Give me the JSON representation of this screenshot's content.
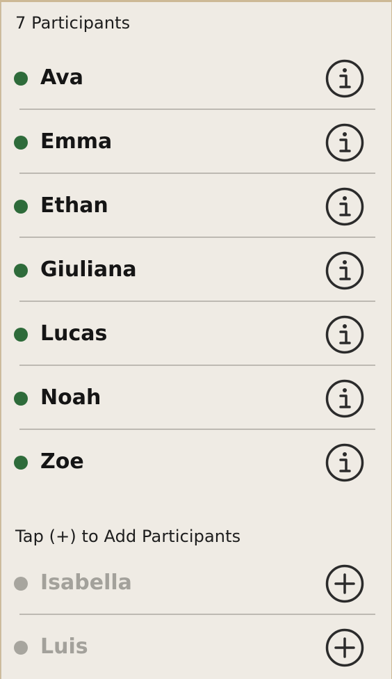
{
  "participants": {
    "title": "7 Participants",
    "items": [
      {
        "name": "Ava"
      },
      {
        "name": "Emma"
      },
      {
        "name": "Ethan"
      },
      {
        "name": "Giuliana"
      },
      {
        "name": "Lucas"
      },
      {
        "name": "Noah"
      },
      {
        "name": "Zoe"
      }
    ],
    "action_icon": "info-icon",
    "status_color": "#2e6b3a"
  },
  "available": {
    "title": "Tap (+) to Add Participants",
    "items": [
      {
        "name": "Isabella"
      },
      {
        "name": "Luis"
      }
    ],
    "action_icon": "add-icon",
    "status_color": "#a7a59e"
  },
  "colors": {
    "background": "#efebe4",
    "icon_stroke": "#2b2b2b",
    "divider": "#bdb9b2"
  }
}
